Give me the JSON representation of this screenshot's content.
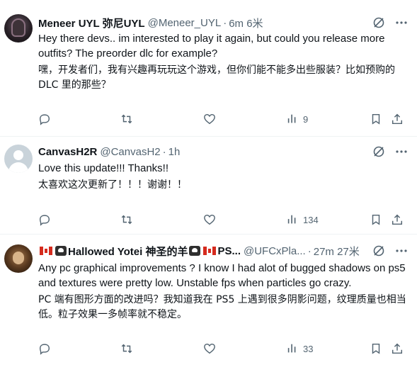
{
  "tweets": [
    {
      "display_name": "Meneer UYL 弥尼UYL",
      "handle": "@Meneer_UYL",
      "separator": "·",
      "time": "6m 6米",
      "text_en": "Hey there devs.. im interested to play it again, but could you release more outfits? The preorder dlc for example?",
      "text_zh": "嘿，开发者们，我有兴趣再玩玩这个游戏，但你们能不能多出些服装？比如预购的 DLC 里的那些？",
      "views": "9"
    },
    {
      "display_name": "CanvasH2R",
      "handle": "@CanvasH2",
      "separator": "·",
      "time": "1h",
      "text_en": "Love this update!!! Thanks!!",
      "text_zh": "太喜欢这次更新了！！！谢谢！！",
      "views": "134"
    },
    {
      "display_name_main": "Hallowed Yotei 神圣的羊",
      "display_name_tail": "PS...",
      "handle": "@UFCxPla...",
      "separator": "·",
      "time": "27m 27米",
      "text_en": "Any pc graphical improvements ? I know I had alot of bugged shadows on ps5 and textures were pretty low. Unstable fps when particles go crazy.",
      "text_zh": "PC 端有图形方面的改进吗？我知道我在 PS5 上遇到很多阴影问题，纹理质量也相当低。粒子效果一多帧率就不稳定。",
      "views": "33"
    }
  ],
  "icons": {
    "reply": "reply-icon",
    "retweet": "retweet-icon",
    "like": "heart-icon",
    "views": "views-icon",
    "bookmark": "bookmark-icon",
    "share": "share-icon",
    "grok": "grok-icon",
    "more": "more-icon"
  },
  "colors": {
    "text": "#0f1419",
    "muted": "#536471",
    "divider": "#eff3f4"
  }
}
